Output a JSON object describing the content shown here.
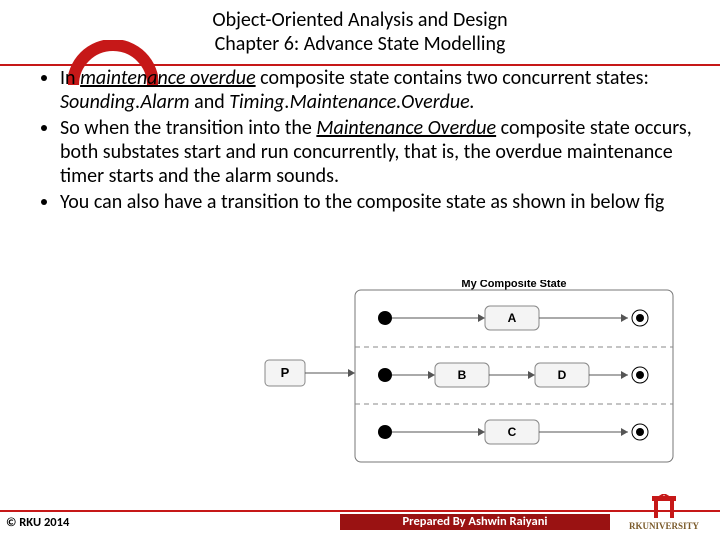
{
  "header": {
    "title": "Object-Oriented Analysis and Design",
    "subtitle": "Chapter 6: Advance State Modelling"
  },
  "bullets": [
    {
      "prefix": "In ",
      "state_name": "maintenance overdue",
      "mid1": " composite state contains two concurrent states: ",
      "sub1": "Sounding.Alarm",
      "mid2": " and ",
      "sub2": "Timing.Maintenance.Overdue."
    },
    {
      "prefix": "So when the transition into the ",
      "state_name": "Maintenance Overdue",
      "rest": " composite state occurs, both substates start and run concurrently, that is, the overdue maintenance timer starts and the alarm sounds."
    },
    {
      "text": "You can also have a transition to the composite state as shown in below fig"
    }
  ],
  "diagram": {
    "title": "My Composite State",
    "outside_state": "P",
    "regions": [
      {
        "states": [
          "A"
        ],
        "has_final": true
      },
      {
        "states": [
          "B",
          "D"
        ],
        "has_final": true
      },
      {
        "states": [
          "C"
        ],
        "has_final": true
      }
    ]
  },
  "footer": {
    "left": "© RKU 2014",
    "center": "Prepared By Ashwin Raiyani",
    "logo_text": "RKUNIVERSITY"
  },
  "colors": {
    "accent": "#C61818",
    "footer_bg": "#9a1212"
  }
}
